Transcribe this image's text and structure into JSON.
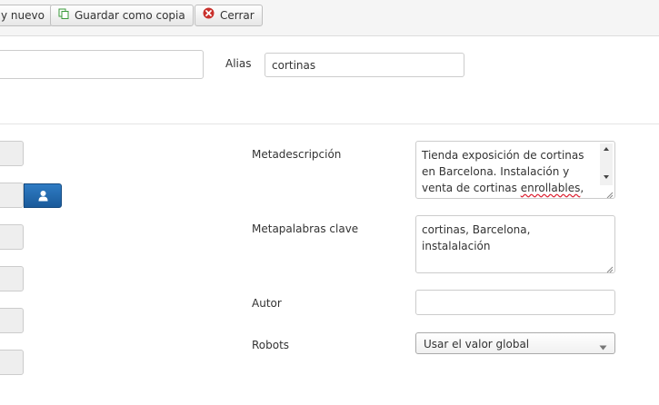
{
  "toolbar": {
    "save_new_label": "y nuevo",
    "save_copy_label": "Guardar como copia",
    "close_label": "Cerrar"
  },
  "form": {
    "title_value": "",
    "alias_label": "Alias",
    "alias_value": "cortinas",
    "metadesc_label": "Metadescripción",
    "metadesc_lines": {
      "line1": "Tienda exposición de cortinas",
      "line2": "en Barcelona. Instalación y",
      "line3_start": "venta de cortinas ",
      "line3_misspelled": "enrollables",
      "line3_end": ","
    },
    "metakeys_label": "Metapalabras clave",
    "metakeys_value": "cortinas, Barcelona, instalalación",
    "author_label": "Autor",
    "author_value": "",
    "robots_label": "Robots",
    "robots_value": "Usar el valor global"
  },
  "colors": {
    "accent_button": "#1a5a9a",
    "close_icon": "#c9302c",
    "copy_icon": "#3a9a3a",
    "spell_underline": "#dd2233"
  },
  "icons": {
    "copy": "copy-icon",
    "close": "close-circle-icon",
    "user": "user-icon"
  }
}
